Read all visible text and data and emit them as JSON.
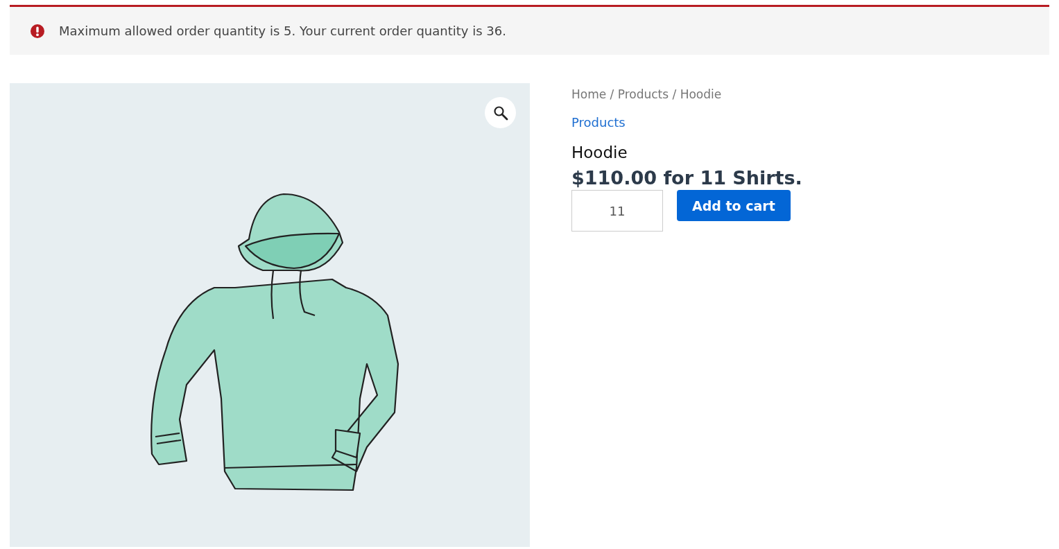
{
  "notice": {
    "message": "Maximum allowed order quantity is 5. Your current order quantity is 36."
  },
  "breadcrumb": "Home / Products / Hoodie",
  "category_link": "Products",
  "product": {
    "title": "Hoodie",
    "price": "$110.00 for 11 Shirts.",
    "quantity": "11",
    "button": "Add to cart"
  }
}
